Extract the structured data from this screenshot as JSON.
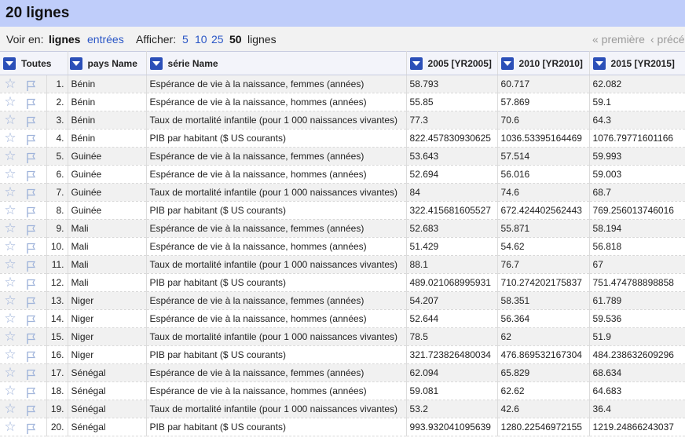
{
  "header": {
    "title": "20 lignes"
  },
  "controls": {
    "view_label": "Voir en:",
    "view_rows": "lignes",
    "view_records": "entrées",
    "show_label": "Afficher:",
    "page_sizes": [
      "5",
      "10",
      "25",
      "50"
    ],
    "page_size_suffix": "lignes",
    "first_link": "« première",
    "prev_link": "‹ précé"
  },
  "columns": {
    "all": "Toutes",
    "country": "pays Name",
    "series": "série Name",
    "y2005": "2005 [YR2005]",
    "y2010": "2010 [YR2010]",
    "y2015": "2015 [YR2015]"
  },
  "icons": {
    "star": "star-icon",
    "flag": "flag-icon",
    "dropdown": "dropdown-arrow-icon"
  },
  "rows": [
    {
      "idx": "1.",
      "country": "Bénin",
      "series": "Espérance de vie à la naissance, femmes (années)",
      "v2005": "58.793",
      "v2010": "60.717",
      "v2015": "62.082"
    },
    {
      "idx": "2.",
      "country": "Bénin",
      "series": "Espérance de vie à la naissance, hommes (années)",
      "v2005": "55.85",
      "v2010": "57.869",
      "v2015": "59.1"
    },
    {
      "idx": "3.",
      "country": "Bénin",
      "series": "Taux de mortalité infantile (pour 1 000 naissances vivantes)",
      "v2005": "77.3",
      "v2010": "70.6",
      "v2015": "64.3"
    },
    {
      "idx": "4.",
      "country": "Bénin",
      "series": "PIB par habitant ($ US courants)",
      "v2005": "822.457830930625",
      "v2010": "1036.53395164469",
      "v2015": "1076.79771601166"
    },
    {
      "idx": "5.",
      "country": "Guinée",
      "series": "Espérance de vie à la naissance, femmes (années)",
      "v2005": "53.643",
      "v2010": "57.514",
      "v2015": "59.993"
    },
    {
      "idx": "6.",
      "country": "Guinée",
      "series": "Espérance de vie à la naissance, hommes (années)",
      "v2005": "52.694",
      "v2010": "56.016",
      "v2015": "59.003"
    },
    {
      "idx": "7.",
      "country": "Guinée",
      "series": "Taux de mortalité infantile (pour 1 000 naissances vivantes)",
      "v2005": "84",
      "v2010": "74.6",
      "v2015": "68.7"
    },
    {
      "idx": "8.",
      "country": "Guinée",
      "series": "PIB par habitant ($ US courants)",
      "v2005": "322.415681605527",
      "v2010": "672.424402562443",
      "v2015": "769.256013746016"
    },
    {
      "idx": "9.",
      "country": "Mali",
      "series": "Espérance de vie à la naissance, femmes (années)",
      "v2005": "52.683",
      "v2010": "55.871",
      "v2015": "58.194"
    },
    {
      "idx": "10.",
      "country": "Mali",
      "series": "Espérance de vie à la naissance, hommes (années)",
      "v2005": "51.429",
      "v2010": "54.62",
      "v2015": "56.818"
    },
    {
      "idx": "11.",
      "country": "Mali",
      "series": "Taux de mortalité infantile (pour 1 000 naissances vivantes)",
      "v2005": "88.1",
      "v2010": "76.7",
      "v2015": "67"
    },
    {
      "idx": "12.",
      "country": "Mali",
      "series": "PIB par habitant ($ US courants)",
      "v2005": "489.021068995931",
      "v2010": "710.274202175837",
      "v2015": "751.474788898858"
    },
    {
      "idx": "13.",
      "country": "Niger",
      "series": "Espérance de vie à la naissance, femmes (années)",
      "v2005": "54.207",
      "v2010": "58.351",
      "v2015": "61.789"
    },
    {
      "idx": "14.",
      "country": "Niger",
      "series": "Espérance de vie à la naissance, hommes (années)",
      "v2005": "52.644",
      "v2010": "56.364",
      "v2015": "59.536"
    },
    {
      "idx": "15.",
      "country": "Niger",
      "series": "Taux de mortalité infantile (pour 1 000 naissances vivantes)",
      "v2005": "78.5",
      "v2010": "62",
      "v2015": "51.9"
    },
    {
      "idx": "16.",
      "country": "Niger",
      "series": "PIB par habitant ($ US courants)",
      "v2005": "321.723826480034",
      "v2010": "476.869532167304",
      "v2015": "484.238632609296"
    },
    {
      "idx": "17.",
      "country": "Sénégal",
      "series": "Espérance de vie à la naissance, femmes (années)",
      "v2005": "62.094",
      "v2010": "65.829",
      "v2015": "68.634"
    },
    {
      "idx": "18.",
      "country": "Sénégal",
      "series": "Espérance de vie à la naissance, hommes (années)",
      "v2005": "59.081",
      "v2010": "62.62",
      "v2015": "64.683"
    },
    {
      "idx": "19.",
      "country": "Sénégal",
      "series": "Taux de mortalité infantile (pour 1 000 naissances vivantes)",
      "v2005": "53.2",
      "v2010": "42.6",
      "v2015": "36.4"
    },
    {
      "idx": "20.",
      "country": "Sénégal",
      "series": "PIB par habitant ($ US courants)",
      "v2005": "993.932041095639",
      "v2010": "1280.22546972155",
      "v2015": "1219.24866243037"
    }
  ]
}
